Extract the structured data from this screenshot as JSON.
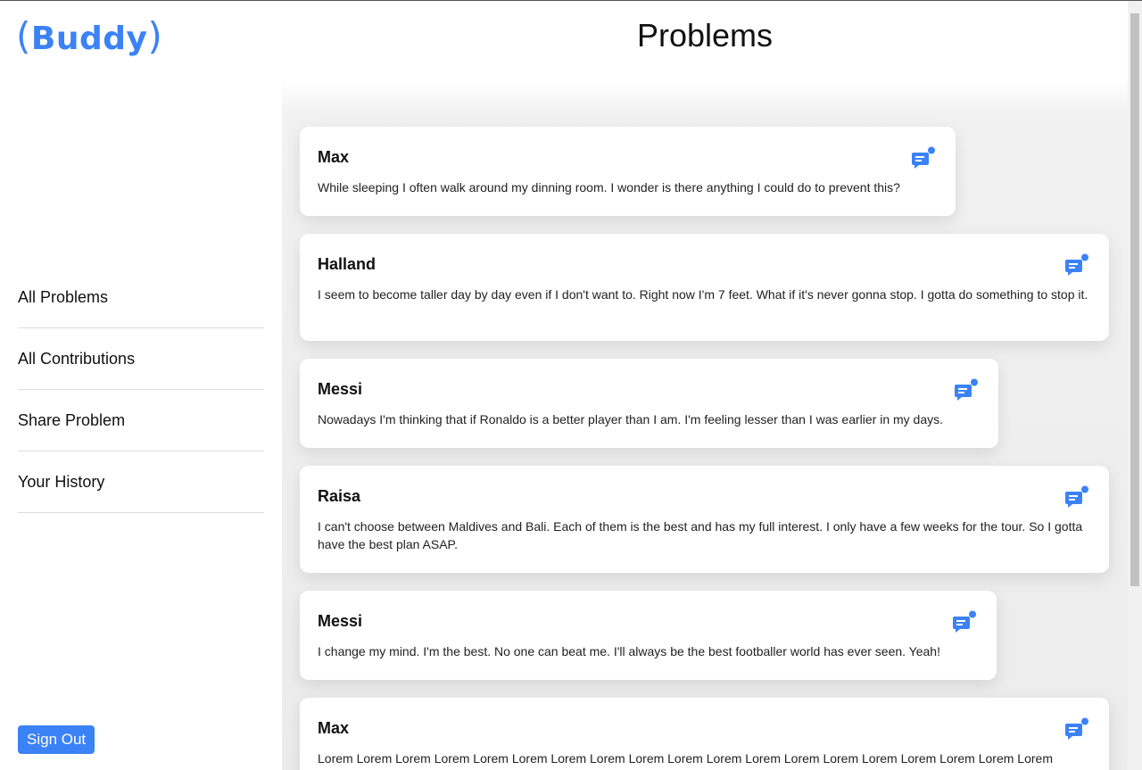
{
  "app": {
    "logo_open": "(",
    "logo_text": "Buddy",
    "logo_close": ")"
  },
  "sidebar": {
    "items": [
      {
        "label": "All Problems"
      },
      {
        "label": "All Contributions"
      },
      {
        "label": "Share Problem"
      },
      {
        "label": "Your History"
      }
    ],
    "signout_label": "Sign Out"
  },
  "main": {
    "title": "Problems",
    "problems": [
      {
        "name": "Max",
        "text": "While sleeping I often walk around my dinning room. I wonder is there anything I could do to prevent this?",
        "icon": "chat-notification-icon"
      },
      {
        "name": "Halland",
        "text": "I seem to become taller day by day even if I don't want to. Right now I'm 7 feet. What if it's never gonna stop. I gotta do something to stop it.",
        "icon": "chat-notification-icon"
      },
      {
        "name": "Messi",
        "text": "Nowadays I'm thinking that if Ronaldo is a better player than I am. I'm feeling lesser than I was earlier in my days.",
        "icon": "chat-notification-icon"
      },
      {
        "name": "Raisa",
        "text": "I can't choose between Maldives and Bali. Each of them is the best and has my full interest. I only have a few weeks for the tour. So I gotta have the best plan ASAP.",
        "icon": "chat-notification-icon"
      },
      {
        "name": "Messi",
        "text": "I change my mind. I'm the best. No one can beat me. I'll always be the best footballer world has ever seen. Yeah!",
        "icon": "chat-notification-icon"
      },
      {
        "name": "Max",
        "text": "Lorem Lorem Lorem Lorem Lorem Lorem Lorem Lorem Lorem Lorem Lorem Lorem Lorem Lorem Lorem Lorem Lorem Lorem Lorem",
        "icon": "chat-notification-icon"
      }
    ]
  },
  "colors": {
    "accent": "#3b82f6",
    "text": "#111111",
    "divider": "#dcdcdc"
  }
}
